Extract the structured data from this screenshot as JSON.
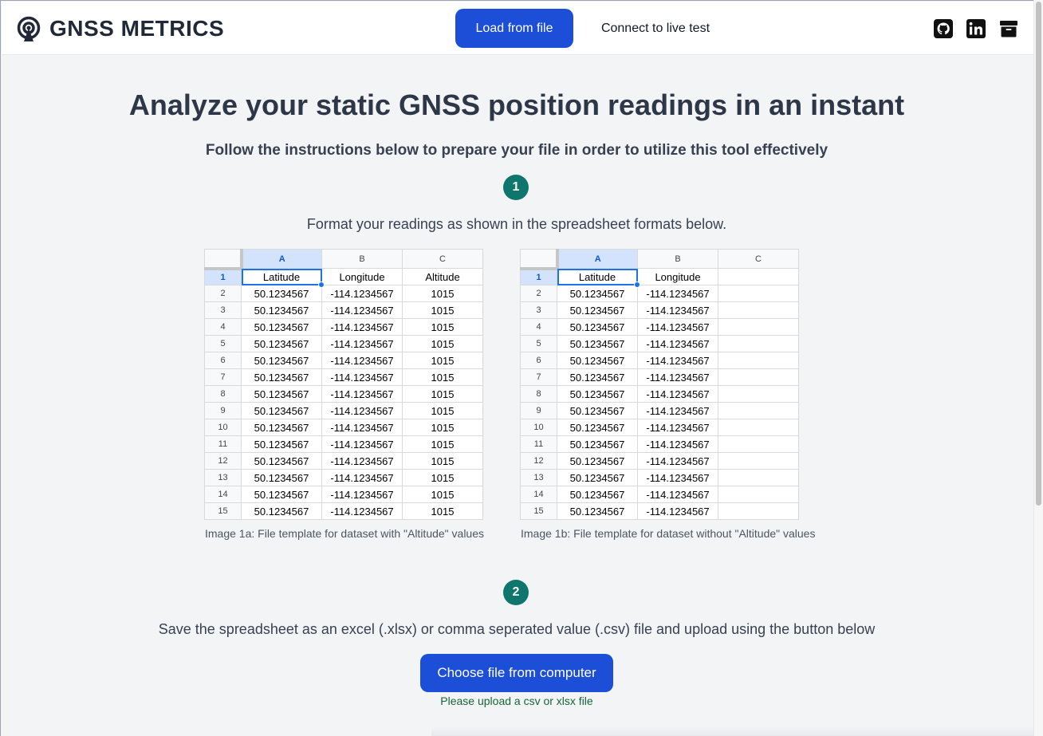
{
  "header": {
    "logo_text": "GNSS METRICS",
    "nav_load": "Load from file",
    "nav_live": "Connect to live test",
    "social_icons": [
      "github-icon",
      "linkedin-icon",
      "archive-icon"
    ]
  },
  "main": {
    "title": "Analyze your static GNSS position readings in an instant",
    "subtitle": "Follow the instructions below to prepare your file in order to utilize this tool effectively",
    "step1": {
      "number": "1",
      "text": "Format your readings as shown in the spreadsheet formats below."
    },
    "step2": {
      "number": "2",
      "text": "Save the spreadsheet as an excel (.xlsx) or comma seperated value (.csv) file and upload using the button below"
    },
    "upload_button": "Choose file from computer",
    "upload_hint": "Please upload a csv or xlsx file"
  },
  "sheet_a": {
    "caption": "Image 1a: File template for dataset with \"Altitude\" values",
    "columns": [
      "A",
      "B",
      "C"
    ],
    "header_row": [
      "Latitude",
      "Longitude",
      "Altitude"
    ],
    "row_value": [
      "50.1234567",
      "-114.1234567",
      "1015"
    ],
    "rows": [
      "2",
      "3",
      "4",
      "5",
      "6",
      "7",
      "8",
      "9",
      "10",
      "11",
      "12",
      "13",
      "14",
      "15"
    ]
  },
  "sheet_b": {
    "caption": "Image 1b: File template for dataset without \"Altitude\" values",
    "columns": [
      "A",
      "B",
      "C"
    ],
    "header_row": [
      "Latitude",
      "Longitude",
      ""
    ],
    "row_value": [
      "50.1234567",
      "-114.1234567",
      ""
    ],
    "rows": [
      "2",
      "3",
      "4",
      "5",
      "6",
      "7",
      "8",
      "9",
      "10",
      "11",
      "12",
      "13",
      "14",
      "15"
    ]
  },
  "colors": {
    "primary": "#1d4ed8",
    "badge": "#0f766e",
    "hint": "#166534"
  }
}
